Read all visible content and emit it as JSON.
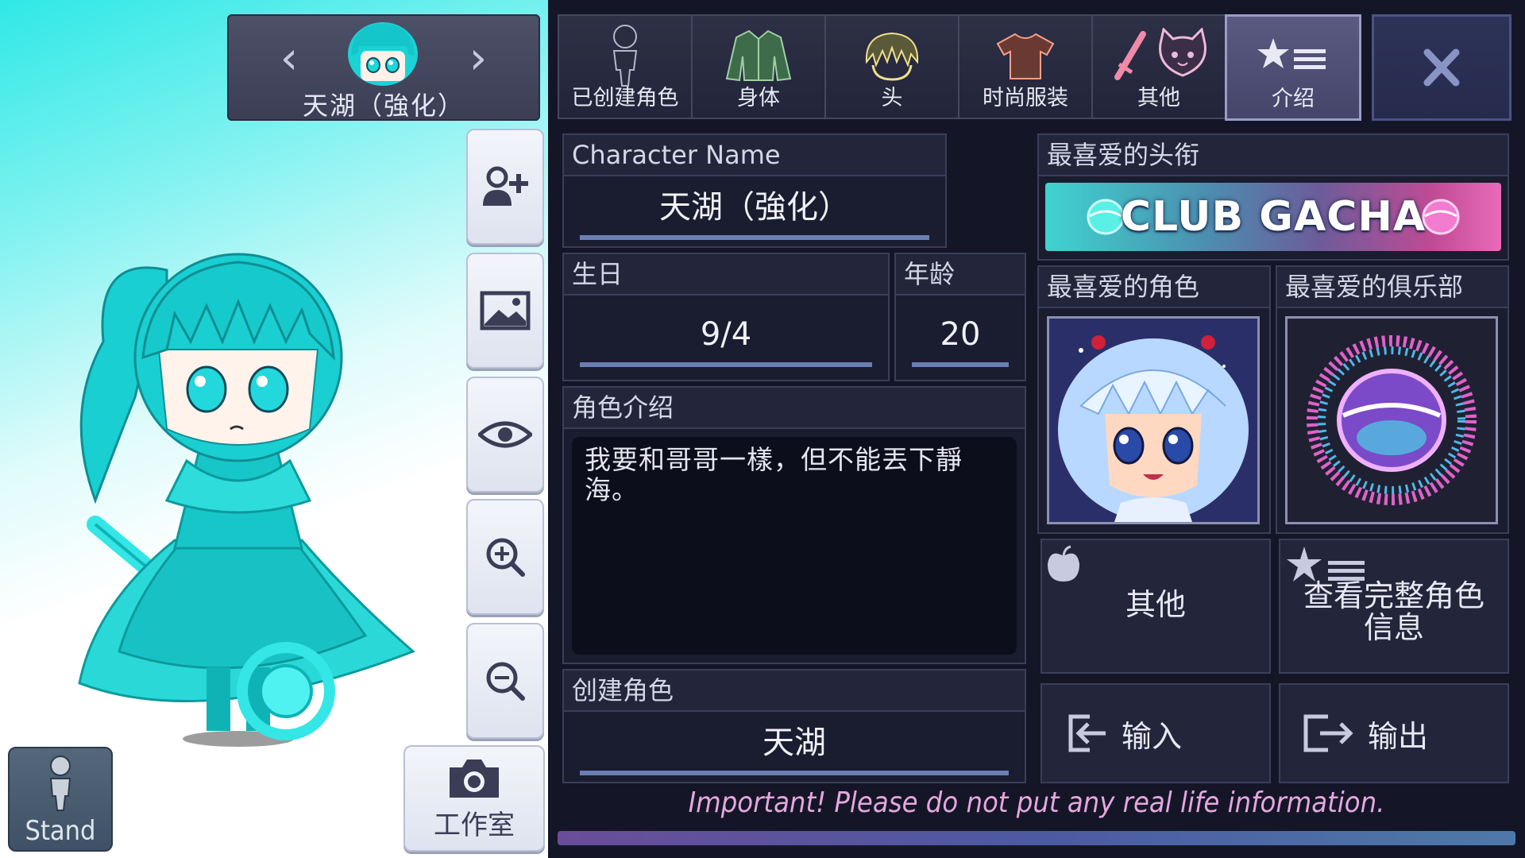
{
  "left": {
    "selected_character": "天湖（強化）",
    "stand_label": "Stand",
    "studio_label": "工作室"
  },
  "tabs": [
    {
      "label": "已创建角色",
      "icon": "person-silhouette-icon"
    },
    {
      "label": "身体",
      "icon": "jacket-icon"
    },
    {
      "label": "头",
      "icon": "hair-icon"
    },
    {
      "label": "时尚服装",
      "icon": "tshirt-icon"
    },
    {
      "label": "其他",
      "icon": "sword-cat-icon"
    },
    {
      "label": "介绍",
      "icon": "star-list-icon"
    }
  ],
  "active_tab": "介绍",
  "profile": {
    "name_header": "Character Name",
    "name_value": "天湖（強化）",
    "birthday_header": "生日",
    "birthday_value": "9/4",
    "age_header": "年龄",
    "age_value": "20",
    "bio_header": "角色介绍",
    "bio_text": "我要和哥哥一樣，但不能丟下靜海。",
    "creator_header": "创建角色",
    "creator_value": "天湖"
  },
  "favorites": {
    "title_header": "最喜爱的头衔",
    "title_banner": "CLUB GACHA",
    "character_header": "最喜爱的角色",
    "club_header": "最喜爱的俱乐部"
  },
  "actions": {
    "other_label": "其他",
    "full_info_label": "查看完整角色信息",
    "import_label": "输入",
    "export_label": "输出"
  },
  "footer_notice": "Important! Please do not put any real life information.",
  "colors": {
    "accent_teal": "#2fe8e6",
    "panel_bg": "#1a1c30",
    "notice_pink": "#e5a7de",
    "active_tab": "#5a5a82"
  }
}
